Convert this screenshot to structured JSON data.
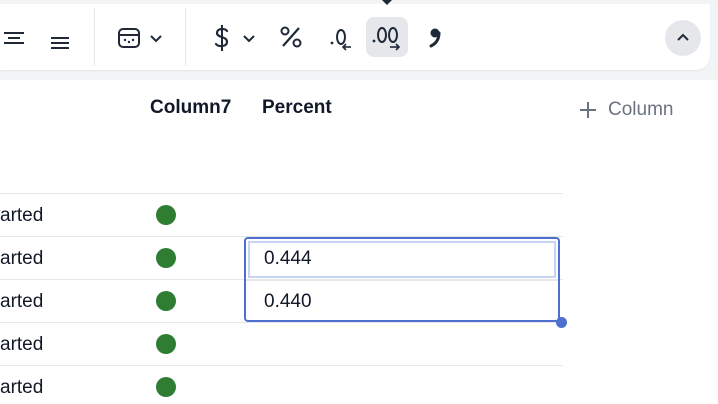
{
  "toolbar": {
    "icons": [
      "align-center-icon",
      "align-justify-icon",
      "calendar-format-icon",
      "chevron-down-icon",
      "dollar-icon",
      "chevron-down-icon",
      "percent-icon",
      "decrease-decimals-icon",
      "increase-decimals-icon",
      "thousands-separator-icon",
      "chevron-up-icon"
    ],
    "active": "increase-decimals"
  },
  "table": {
    "headers": {
      "col7": "Column7",
      "percent": "Percent"
    },
    "add_column_label": "Column",
    "rows": [
      {
        "status": "arted",
        "status_color": "#2e7d32",
        "percent": ""
      },
      {
        "status": "arted",
        "status_color": "#2e7d32",
        "percent": "0.444"
      },
      {
        "status": "arted",
        "status_color": "#2e7d32",
        "percent": "0.440"
      },
      {
        "status": "arted",
        "status_color": "#2e7d32",
        "percent": ""
      },
      {
        "status": "arted",
        "status_color": "#2e7d32",
        "percent": ""
      }
    ]
  },
  "colors": {
    "accent": "#4f6fd0",
    "status_green": "#2e7d32"
  }
}
